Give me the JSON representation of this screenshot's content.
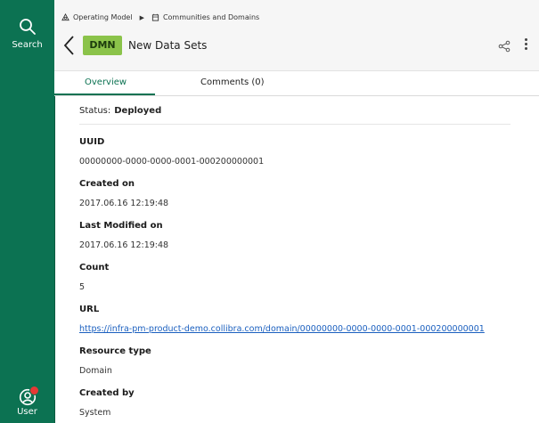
{
  "sidebar": {
    "search_label": "Search",
    "user_label": "User"
  },
  "header": {
    "breadcrumb": [
      "Operating Model",
      "Communities and Domains"
    ],
    "badge": "DMN",
    "title": "New Data Sets"
  },
  "tabs": [
    "Overview",
    "Comments (0)"
  ],
  "status": {
    "label": "Status:",
    "value": "Deployed"
  },
  "fields": [
    {
      "label": "UUID",
      "value": "00000000-0000-0000-0001-000200000001"
    },
    {
      "label": "Created on",
      "value": "2017.06.16 12:19:48"
    },
    {
      "label": "Last Modified on",
      "value": "2017.06.16 12:19:48"
    },
    {
      "label": "Count",
      "value": "5"
    },
    {
      "label": "URL",
      "value": "https://infra-pm-product-demo.collibra.com/domain/00000000-0000-0000-0001-000200000001"
    },
    {
      "label": "Resource type",
      "value": "Domain"
    },
    {
      "label": "Created by",
      "value": "System"
    }
  ],
  "colors": {
    "sidebar": "#0c7252",
    "badge": "#8bc34a",
    "active_tab": "#0c7252",
    "notification_dot": "#e53935",
    "link": "#1a5fbf"
  },
  "icons": [
    "search-icon",
    "user-icon",
    "back-icon",
    "share-icon",
    "more-icon"
  ]
}
